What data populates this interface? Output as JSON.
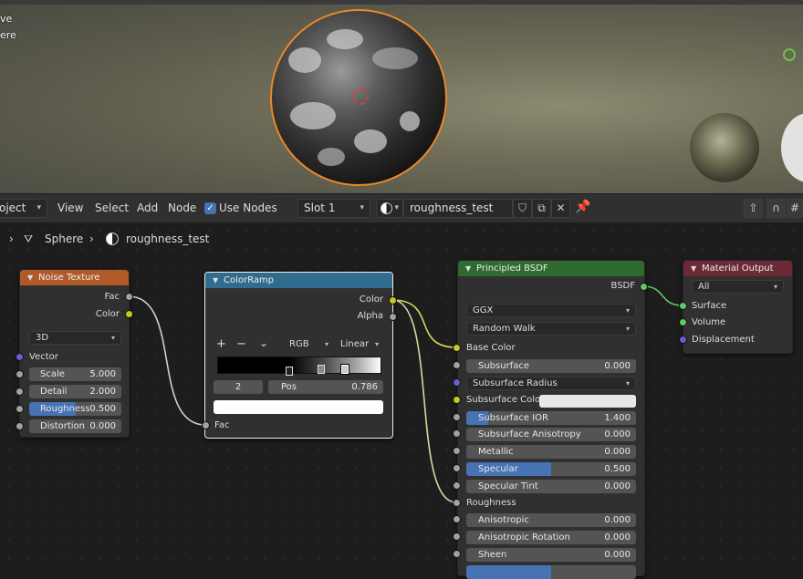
{
  "viewport": {
    "overlay_line1": "ve",
    "overlay_line2": "ere"
  },
  "header": {
    "object_menu": "oject",
    "view": "View",
    "select": "Select",
    "add": "Add",
    "node": "Node",
    "use_nodes": "Use Nodes",
    "slot": "Slot 1",
    "material_name": "roughness_test"
  },
  "breadcrumb": {
    "object": "Sphere",
    "material": "roughness_test"
  },
  "noise": {
    "title": "Noise Texture",
    "out_fac": "Fac",
    "out_color": "Color",
    "dimensions": "3D",
    "in_vector": "Vector",
    "scale_label": "Scale",
    "scale_value": "5.000",
    "detail_label": "Detail",
    "detail_value": "2.000",
    "roughness_label": "Roughness",
    "roughness_value": "0.500",
    "roughness_fraction": 0.5,
    "distortion_label": "Distortion",
    "distortion_value": "0.000"
  },
  "colorramp": {
    "title": "ColorRamp",
    "out_color": "Color",
    "out_alpha": "Alpha",
    "add": "+",
    "remove": "−",
    "menu": "⌄",
    "color_mode": "RGB",
    "interpolation": "Linear",
    "stop_index": "2",
    "pos_label": "Pos",
    "pos_value": "0.786",
    "in_fac": "Fac"
  },
  "bsdf": {
    "title": "Principled BSDF",
    "out_bsdf": "BSDF",
    "distribution": "GGX",
    "subsurface_method": "Random Walk",
    "base_color": "Base Color",
    "subsurface_label": "Subsurface",
    "subsurface_value": "0.000",
    "subsurface_radius": "Subsurface Radius",
    "subsurface_color": "Subsurface Color",
    "ior_label": "Subsurface IOR",
    "ior_value": "1.400",
    "aniso_label": "Subsurface Anisotropy",
    "aniso_value": "0.000",
    "metallic_label": "Metallic",
    "metallic_value": "0.000",
    "specular_label": "Specular",
    "specular_value": "0.500",
    "specular_fraction": 0.5,
    "spectint_label": "Specular Tint",
    "spectint_value": "0.000",
    "roughness": "Roughness",
    "anisotropic_label": "Anisotropic",
    "anisotropic_value": "0.000",
    "anisorot_label": "Anisotropic Rotation",
    "anisorot_value": "0.000",
    "sheen_label": "Sheen",
    "sheen_value": "0.000"
  },
  "output": {
    "title": "Material Output",
    "target": "All",
    "surface": "Surface",
    "volume": "Volume",
    "displacement": "Displacement"
  },
  "colors": {
    "texture_header": "#b05a2a",
    "converter_header": "#2f6c8e",
    "shader_header": "#2f6a2f",
    "output_header": "#6b2a35",
    "selected_outline": "#e8882a"
  }
}
